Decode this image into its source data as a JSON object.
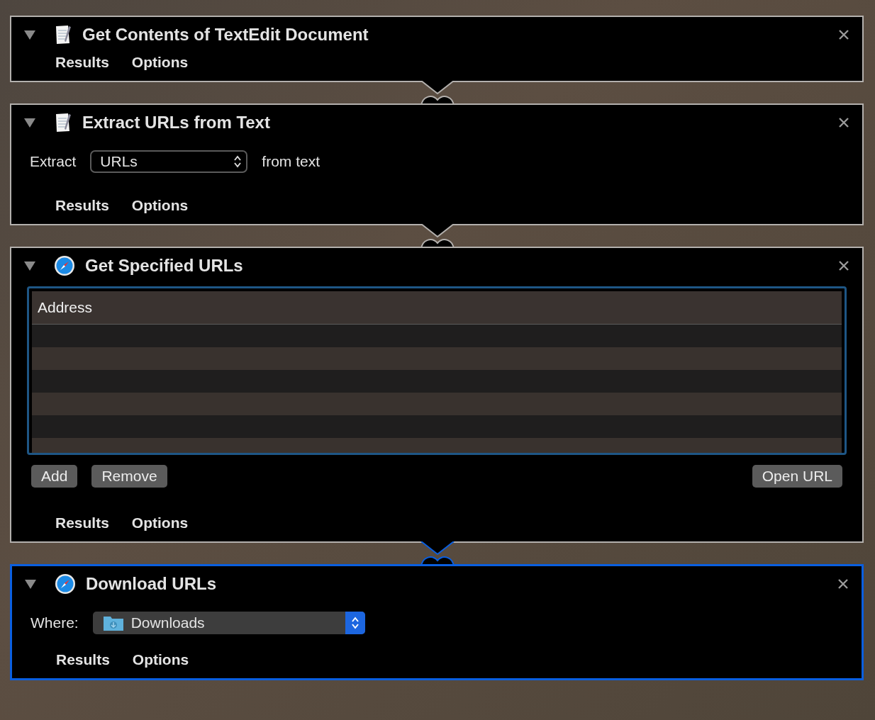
{
  "actions": [
    {
      "kind": "plain",
      "title": "Get Contents of TextEdit Document",
      "expanded": true,
      "selected": false,
      "footer": [
        "Results",
        "Options"
      ]
    },
    {
      "kind": "extract",
      "title": "Extract URLs from Text",
      "expanded": true,
      "selected": false,
      "label": "Extract",
      "popup": "URLs",
      "suffix": "from text",
      "footer": [
        "Results",
        "Options"
      ]
    },
    {
      "kind": "url_table",
      "title": "Get Specified URLs",
      "expanded": true,
      "selected": false,
      "column": "Address",
      "buttons": [
        "Add",
        "Remove"
      ],
      "open_button": "Open URL",
      "footer": [
        "Results",
        "Options"
      ]
    },
    {
      "kind": "download",
      "title": "Download URLs",
      "expanded": true,
      "selected": true,
      "label": "Where:",
      "popup": "Downloads",
      "footer": [
        "Results",
        "Options"
      ]
    }
  ]
}
